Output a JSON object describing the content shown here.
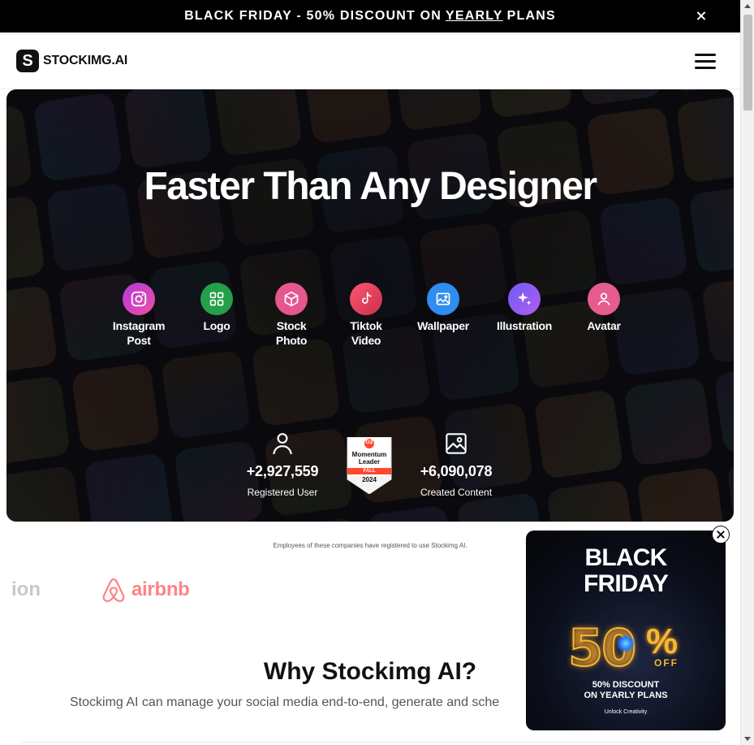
{
  "announcement": {
    "prefix": "BLACK FRIDAY - 50% DISCOUNT ON",
    "emphasis": "YEARLY",
    "suffix": "PLANS"
  },
  "header": {
    "logo_text": "STOCKIMG.AI",
    "logo_mark": "S"
  },
  "hero": {
    "title": "Faster Than Any Designer",
    "categories": [
      {
        "label": "Instagram Post",
        "icon": "instagram-icon",
        "color": "#d23be8"
      },
      {
        "label": "Logo",
        "icon": "grid-icon",
        "color": "#25a04a"
      },
      {
        "label": "Stock Photo",
        "icon": "box-icon",
        "color": "#e5578e"
      },
      {
        "label": "Tiktok Video",
        "icon": "tiktok-icon",
        "color": "#e2445c"
      },
      {
        "label": "Wallpaper",
        "icon": "image-icon",
        "color": "#2f8cf0"
      },
      {
        "label": "Illustration",
        "icon": "sparkle-icon",
        "color": "#8b52f0"
      },
      {
        "label": "Avatar",
        "icon": "user-icon",
        "color": "#e65c8e"
      }
    ],
    "stats": [
      {
        "value": "+2,927,559",
        "caption": "Registered User",
        "icon": "user-outline-icon"
      },
      {
        "value": "+6,090,078",
        "caption": "Created Content",
        "icon": "image-outline-icon"
      }
    ],
    "badge": {
      "brand": "G2",
      "line1": "Momentum",
      "line2": "Leader",
      "season": "FALL",
      "year": "2024"
    }
  },
  "companies": {
    "caption": "Employees of these companies have registered to use Stockimg AI.",
    "logos": [
      "ion",
      "airbnb"
    ]
  },
  "why": {
    "title": "Why Stockimg AI?",
    "text": "Stockimg AI can manage your social media end-to-end, generate and sche"
  },
  "popup": {
    "title_line1": "BLACK",
    "title_line2": "FRIDAY",
    "percent": "50",
    "percent_sign": "%",
    "off": "OFF",
    "discount_line1": "50% DISCOUNT",
    "discount_line2": "ON YEARLY PLANS",
    "tagline": "Unlock Creativity"
  },
  "colors": {
    "brand_dark": "#111111",
    "airbnb": "#ff5a5f",
    "gold": "#f7b733"
  }
}
